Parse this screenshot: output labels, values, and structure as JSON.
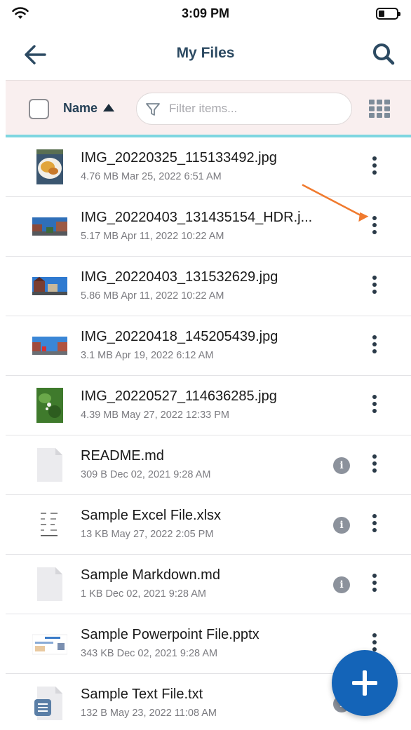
{
  "status_bar": {
    "time": "3:09 PM",
    "wifi_icon": "wifi-icon",
    "battery_icon": "battery-icon"
  },
  "header": {
    "title": "My Files",
    "back_icon": "arrow-left-icon",
    "search_icon": "search-icon"
  },
  "toolbar": {
    "sort_label": "Name",
    "sort_direction": "ascending",
    "filter_placeholder": "Filter items...",
    "filter_value": "",
    "view_toggle_icon": "grid-icon",
    "accent_color": "#7ed6e0",
    "background_color": "#f9efef"
  },
  "files": [
    {
      "name": "IMG_20220325_115133492.jpg",
      "meta": "4.76 MB Mar 25, 2022 6:51 AM",
      "thumb": "photo-food",
      "has_info": false
    },
    {
      "name": "IMG_20220403_131435154_HDR.j...",
      "meta": "5.17 MB Apr 11, 2022 10:22 AM",
      "thumb": "photo-street",
      "has_info": false
    },
    {
      "name": "IMG_20220403_131532629.jpg",
      "meta": "5.86 MB Apr 11, 2022 10:22 AM",
      "thumb": "photo-houses",
      "has_info": false
    },
    {
      "name": "IMG_20220418_145205439.jpg",
      "meta": "3.1 MB Apr 19, 2022 6:12 AM",
      "thumb": "photo-street-red",
      "has_info": false
    },
    {
      "name": "IMG_20220527_114636285.jpg",
      "meta": "4.39 MB May 27, 2022 12:33 PM",
      "thumb": "photo-plant",
      "has_info": false
    },
    {
      "name": "README.md",
      "meta": "309 B Dec 02, 2021 9:28 AM",
      "thumb": "generic-file",
      "has_info": true
    },
    {
      "name": "Sample Excel File.xlsx",
      "meta": "13 KB May 27, 2022 2:05 PM",
      "thumb": "spreadsheet-preview",
      "has_info": true
    },
    {
      "name": "Sample Markdown.md",
      "meta": "1 KB Dec 02, 2021 9:28 AM",
      "thumb": "generic-file",
      "has_info": true
    },
    {
      "name": "Sample Powerpoint File.pptx",
      "meta": "343 KB Dec 02, 2021 9:28 AM",
      "thumb": "slides-preview",
      "has_info": false
    },
    {
      "name": "Sample Text File.txt",
      "meta": "132 B May 23, 2022 11:08 AM",
      "thumb": "text-file",
      "has_info": true
    }
  ],
  "fab": {
    "icon": "plus-icon",
    "color": "#1464b8"
  },
  "annotation": {
    "color": "#f07a2e",
    "target": "file-1-more-button"
  }
}
